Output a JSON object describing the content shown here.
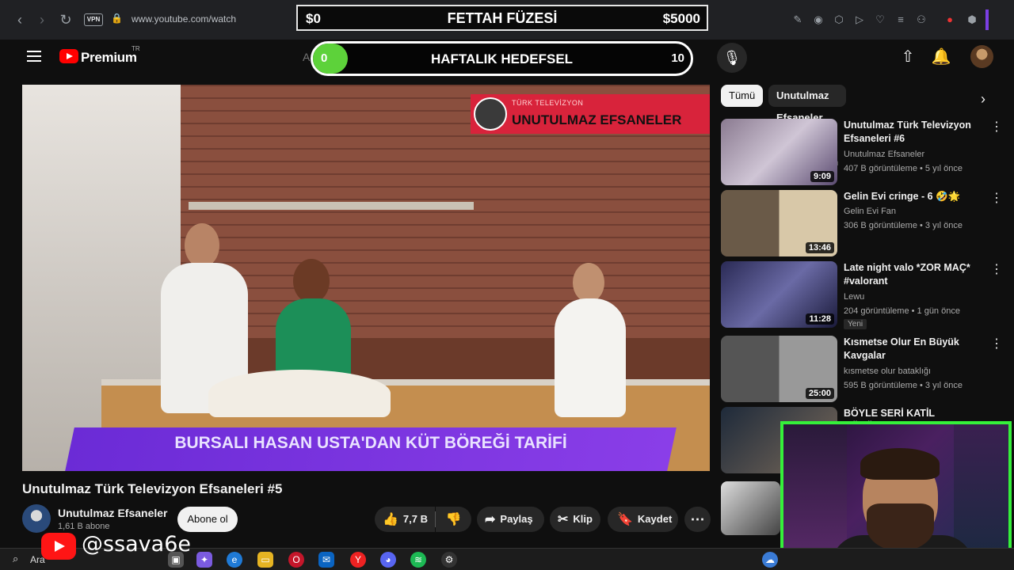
{
  "browser": {
    "url": "www.youtube.com/watch",
    "vpn_label": "VPN"
  },
  "stream_goal": {
    "left_amount": "$0",
    "title": "FETTAH FÜZESİ",
    "right_amount": "$5000"
  },
  "weekly_goal": {
    "progress": "0",
    "title": "HAFTALIK HEDEFSEL",
    "target": "10",
    "search_hint": "A"
  },
  "youtube": {
    "brand": "Premium",
    "region": "TR"
  },
  "video": {
    "banner_sub": "TÜRK TELEVİZYON",
    "banner_main": "UNUTULMAZ EFSANELER",
    "lower_third": "BURSALI HASAN USTA'DAN KÜT BÖREĞİ TARİFİ",
    "title": "Unutulmaz Türk Televizyon Efsaneleri #5",
    "channel": "Unutulmaz Efsaneler",
    "subscribers": "1,61 B abone",
    "subscribe_label": "Abone ol",
    "like_count": "7,7 B",
    "share_label": "Paylaş",
    "clip_label": "Klip",
    "save_label": "Kaydet"
  },
  "chips": {
    "all": "Tümü",
    "uploader": "Unutulmaz Efsaneler adlı yükleyiciden"
  },
  "recommendations": [
    {
      "title": "Unutulmaz Türk Televizyon Efsaneleri #6",
      "channel": "Unutulmaz Efsaneler",
      "meta": "407 B görüntüleme • 5 yıl önce",
      "duration": "9:09"
    },
    {
      "title": "Gelin Evi cringe - 6 🤣🌟",
      "channel": "Gelin Evi Fan",
      "meta": "306 B görüntüleme • 3 yıl önce",
      "duration": "13:46"
    },
    {
      "title": "Late night valo *ZOR MAÇ* #valorant",
      "channel": "Lewu",
      "meta": "204 görüntüleme • 1 gün önce",
      "duration": "11:28",
      "badge": "Yeni"
    },
    {
      "title": "Kısmetse Olur En Büyük Kavgalar",
      "channel": "kısmetse olur bataklığı",
      "meta": "595 B görüntüleme • 3 yıl önce",
      "duration": "25:00"
    },
    {
      "title": "BÖYLE SERİ KATİL GÖRÜLMEDİ!",
      "channel": "",
      "meta": "",
      "duration": ""
    }
  ],
  "overlay": {
    "handle": "@ssava6e"
  },
  "taskbar": {
    "search": "Ara"
  },
  "colors": {
    "youtube_red": "#ff0000",
    "goal_green": "#5dd23a",
    "webcam_border": "#35f03a",
    "banner_red": "#d8233b",
    "lower_third_purple": "#7a34e0"
  }
}
